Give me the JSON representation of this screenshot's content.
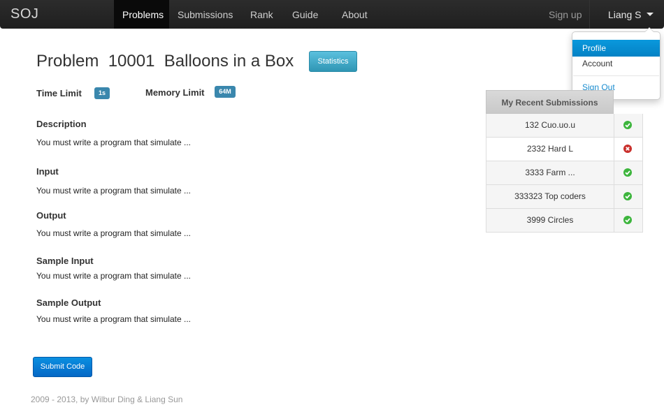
{
  "navbar": {
    "brand": "SOJ",
    "items": [
      {
        "label": "Problems",
        "active": true
      },
      {
        "label": "Submissions",
        "active": false
      },
      {
        "label": "Rank",
        "active": false
      },
      {
        "label": "Guide",
        "active": false
      },
      {
        "label": "About",
        "active": false
      }
    ],
    "signup": "Sign up",
    "user": "Liang S"
  },
  "user_menu": {
    "profile": "Profile",
    "account": "Account",
    "signout": "Sign Out"
  },
  "problem": {
    "title": "Problem  10001  Balloons in a Box",
    "stats_label": "Statistics",
    "time_limit_label": "Time Limit",
    "time_limit": "1s",
    "memory_limit_label": "Memory Limit",
    "memory_limit": "64M",
    "sections": [
      {
        "heading": "Description",
        "text": "You must write a program that simulate ..."
      },
      {
        "heading": "Input",
        "text": "You must write a program that simulate ..."
      },
      {
        "heading": "Output",
        "text": "You must write a program that simulate ..."
      },
      {
        "heading": "Sample Input",
        "text": "You must write a program that simulate ..."
      },
      {
        "heading": "Sample Output",
        "text": "You must write a program that simulate ..."
      }
    ],
    "submit_label": "Submit Code"
  },
  "recent": {
    "heading": "My Recent Submissions",
    "rows": [
      {
        "name": "132 Cuo.uo.u",
        "status": "accepted",
        "icon": "check-icon"
      },
      {
        "name": "2332 Hard L",
        "status": "wrong",
        "icon": "cross-icon"
      },
      {
        "name": "3333 Farm ...",
        "status": "accepted",
        "icon": "check-icon"
      },
      {
        "name": "333323 Top coders",
        "status": "accepted",
        "icon": "check-icon"
      },
      {
        "name": "3999 Circles",
        "status": "accepted",
        "icon": "check-icon"
      }
    ]
  },
  "footer": "2009 - 2013, by Wilbur Ding & Liang Sun",
  "colors": {
    "accent": "#0482c5",
    "info": "#3a87ad",
    "success": "#3db53d",
    "danger": "#c9302c"
  }
}
